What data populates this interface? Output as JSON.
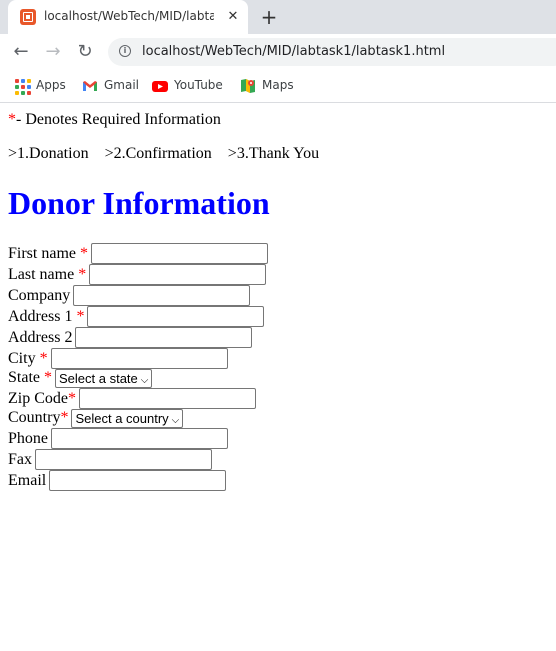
{
  "browser": {
    "tab_title": "localhost/WebTech/MID/labtask1/labtask1.html",
    "tab_close": "✕",
    "new_tab": "+",
    "url": "localhost/WebTech/MID/labtask1/labtask1.html",
    "nav": {
      "back": "←",
      "forward": "→",
      "reload": "↻",
      "info": "i"
    },
    "bookmarks": [
      {
        "label": "Apps",
        "icon": "apps-grid-icon"
      },
      {
        "label": "Gmail",
        "icon": "gmail-icon"
      },
      {
        "label": "YouTube",
        "icon": "youtube-icon"
      },
      {
        "label": "Maps",
        "icon": "maps-icon"
      }
    ]
  },
  "page": {
    "required_marker": "*",
    "required_note": "- Denotes Required Information",
    "steps": ">1.Donation    >2.Confirmation    >3.Thank You",
    "heading": "Donor Information",
    "fields": {
      "first_name": "First name",
      "last_name": "Last name",
      "company": "Company",
      "address1": "Address 1",
      "address2": "Address 2",
      "city": "City",
      "state": "State",
      "state_select": "Select a state",
      "zip": "Zip Code",
      "country": "Country",
      "country_select": "Select a country",
      "phone": "Phone",
      "fax": "Fax",
      "email": "Email"
    }
  },
  "colors": {
    "heading": "#0000ff",
    "required": "#ff0000",
    "tab_favicon": "#e8572a"
  }
}
